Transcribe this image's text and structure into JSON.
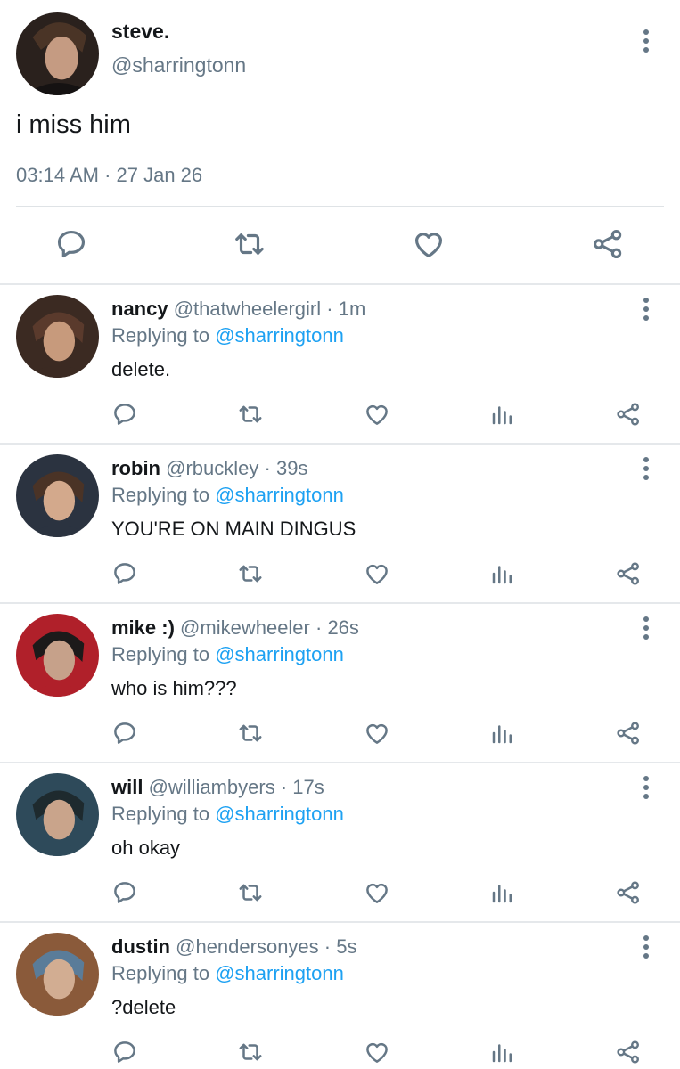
{
  "main_tweet": {
    "name": "steve.",
    "handle": "@sharringtonn",
    "text": "i miss him",
    "time": "03:14 AM",
    "separator": " · ",
    "date": "27 Jan 26"
  },
  "replies": [
    {
      "name": "nancy",
      "handle": "@thatwheelergirl",
      "age": "1m",
      "replying_label": "Replying to",
      "replying_to": "@sharringtonn",
      "text": "delete.",
      "avatar_colors": [
        "#5a3a2c",
        "#c79a7c",
        "#3b2a22"
      ]
    },
    {
      "name": "robin",
      "handle": "@rbuckley",
      "age": "39s",
      "replying_label": "Replying to",
      "replying_to": "@sharringtonn",
      "text": "YOU'RE ON MAIN DINGUS",
      "avatar_colors": [
        "#4a3326",
        "#d3a98c",
        "#2b3340"
      ]
    },
    {
      "name": "mike :)",
      "handle": "@mikewheeler",
      "age": "26s",
      "replying_label": "Replying to",
      "replying_to": "@sharringtonn",
      "text": "who is him???",
      "avatar_colors": [
        "#1c1a1a",
        "#c6a18a",
        "#b0202a"
      ]
    },
    {
      "name": "will",
      "handle": "@williambyers",
      "age": "17s",
      "replying_label": "Replying to",
      "replying_to": "@sharringtonn",
      "text": "oh okay",
      "avatar_colors": [
        "#1e2a2e",
        "#c9a48b",
        "#2e4a5a"
      ]
    },
    {
      "name": "dustin",
      "handle": "@hendersonyes",
      "age": "5s",
      "replying_label": "Replying to",
      "replying_to": "@sharringtonn",
      "text": "?delete",
      "avatar_colors": [
        "#5a7c99",
        "#d2ad92",
        "#8a5a3a"
      ]
    }
  ],
  "icons": {
    "reply": "reply-icon",
    "retweet": "retweet-icon",
    "like": "heart-icon",
    "analytics": "analytics-icon",
    "share": "share-icon",
    "more": "more-vertical-icon"
  },
  "colors": {
    "text": "#14171a",
    "secondary": "#657786",
    "link": "#1da1f2",
    "divider": "#e5e8eb"
  }
}
